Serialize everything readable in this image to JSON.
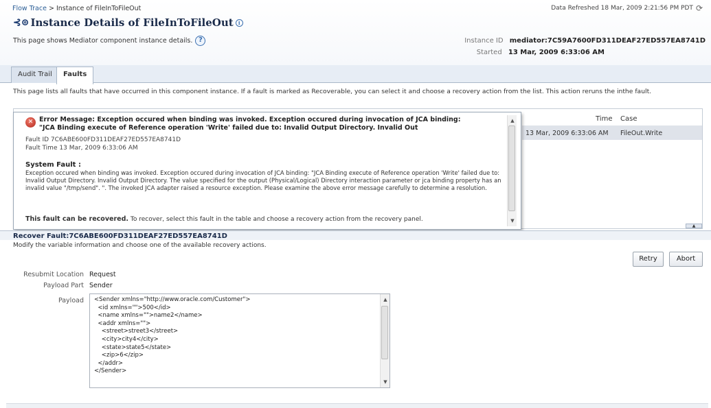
{
  "breadcrumb": {
    "link": "Flow Trace",
    "separator": ">",
    "current": "Instance of FileInToFileOut"
  },
  "refreshed": "Data Refreshed 18 Mar, 2009 2:21:56 PM PDT",
  "title": "Instance Details of FileInToFileOut",
  "subtitle": "This page shows Mediator component instance details.",
  "help_glyph": "?",
  "info_glyph": "i",
  "instance": {
    "id_label": "Instance ID",
    "id_value": "mediator:7C59A7600FD311DEAF27ED557EA8741D",
    "started_label": "Started",
    "started_value": "13 Mar, 2009 6:33:06 AM"
  },
  "tabs": [
    {
      "label": "Audit Trail"
    },
    {
      "label": "Faults"
    }
  ],
  "faults_description": "This page lists all faults that have occurred in this component instance. If a fault is marked as Recoverable, you can select it and choose a recovery action from the list. This action reruns the inthe fault.",
  "table": {
    "columns": [
      "Time",
      "Case"
    ],
    "rows": [
      {
        "time": "13 Mar, 2009 6:33:06 AM",
        "case": "FileOut.Write"
      }
    ]
  },
  "popup": {
    "error_line1": "Error Message: Exception occured when binding was invoked. Exception occured during invocation of JCA binding:",
    "error_line2": "\"JCA Binding execute of Reference operation 'Write' failed due to: Invalid Output Directory. Invalid Out",
    "fault_id_label": "Fault ID",
    "fault_id_value": "7C6ABE600FD311DEAF27ED557EA8741D",
    "fault_time_label": "Fault Time",
    "fault_time_value": "13 Mar, 2009 6:33:06 AM",
    "system_fault_label": "System Fault :",
    "system_fault_text": "Exception occured when binding was invoked. Exception occured during invocation of JCA binding: \"JCA Binding execute of Reference operation 'Write' failed due to: Invalid Output Directory. Invalid Output Directory. The value specified for the output (Physical/Logical) Directory interaction parameter or jca binding property has an invalid value \"/tmp/send\". \". The invoked JCA adapter raised a resource exception. Please examine the above error message carefully to determine a resolution.",
    "recoverable_bold": "This fault can be recovered.",
    "recoverable_rest": "To recover, select this fault in the table and choose a recovery action from the recovery panel."
  },
  "recover": {
    "title": "Recover Fault:7C6ABE600FD311DEAF27ED557EA8741D",
    "description": "Modify the variable information and choose one of the available recovery actions.",
    "retry_label": "Retry",
    "abort_label": "Abort",
    "resubmit_label": "Resubmit Location",
    "resubmit_value": "Request",
    "payload_part_label": "Payload Part",
    "payload_part_value": "Sender",
    "payload_label": "Payload",
    "payload": "<Sender xmlns=\"http://www.oracle.com/Customer\">\n  <id xmlns=\"\">500</id>\n  <name xmlns=\"\">name2</name>\n  <addr xmlns=\"\">\n    <street>street3</street>\n    <city>city4</city>\n    <state>state5</state>\n    <zip>6</zip>\n  </addr>\n</Sender>"
  },
  "icons": {
    "refresh": "refresh-icon",
    "title": "mediator-component-icon",
    "error": "error-icon",
    "help": "help-icon"
  },
  "colors": {
    "accent": "#2a5d96",
    "title": "#1a2b4a",
    "error": "#b3271c",
    "selected_row": "#dfe3ea"
  }
}
